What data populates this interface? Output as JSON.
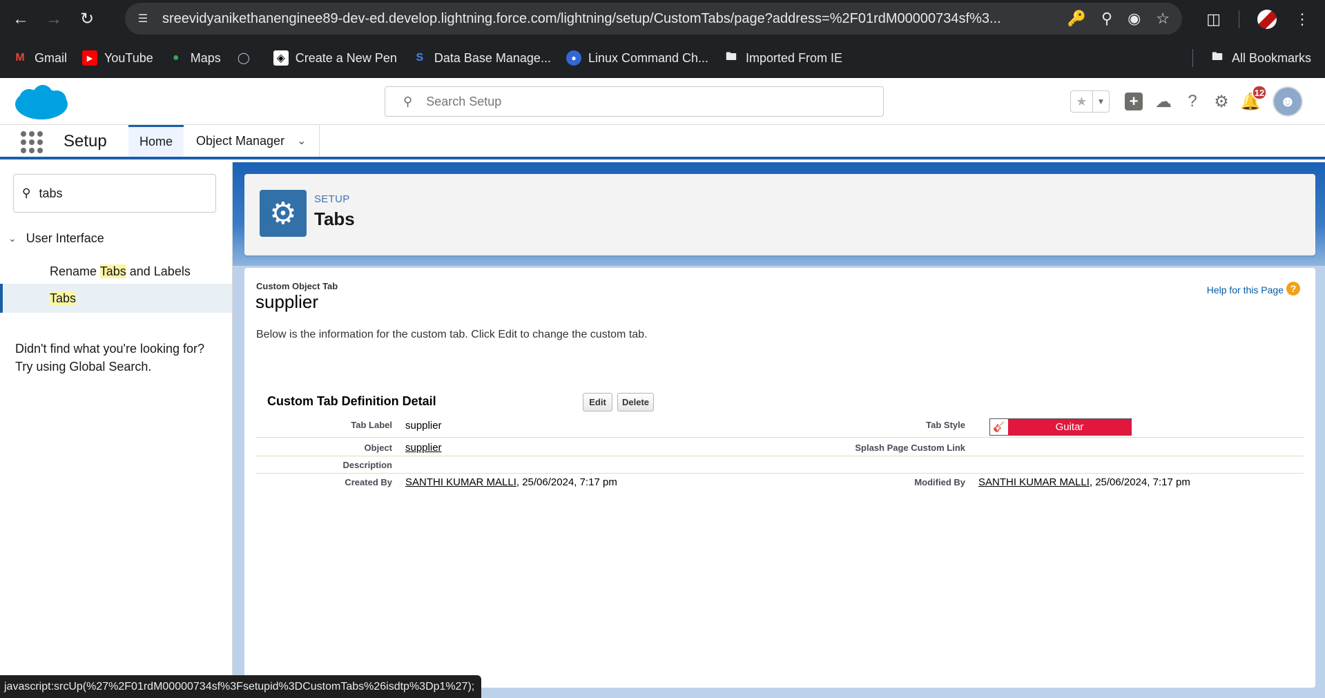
{
  "browser": {
    "url": "sreevidyanikethanenginee89-dev-ed.develop.lightning.force.com/lightning/setup/CustomTabs/page?address=%2F01rdM00000734sf%3...",
    "bookmarks": [
      {
        "label": "Gmail",
        "icon": "gmail-icon"
      },
      {
        "label": "YouTube",
        "icon": "youtube-icon"
      },
      {
        "label": "Maps",
        "icon": "maps-icon"
      },
      {
        "label": "",
        "icon": "globe-icon"
      },
      {
        "label": "Create a New Pen",
        "icon": "codepen-icon"
      },
      {
        "label": "Data Base Manage...",
        "icon": "s-logo-icon"
      },
      {
        "label": "Linux Command Ch...",
        "icon": "blue-circle-icon"
      },
      {
        "label": "Imported From IE",
        "icon": "folder-icon"
      }
    ],
    "all_bookmarks": "All Bookmarks",
    "status_url": "javascript:srcUp(%27%2F01rdM00000734sf%3Fsetupid%3DCustomTabs%26isdtp%3Dp1%27);"
  },
  "header": {
    "search_placeholder": "Search Setup",
    "notification_count": "12"
  },
  "nav": {
    "app_name": "Setup",
    "tabs": [
      {
        "label": "Home"
      },
      {
        "label": "Object Manager"
      }
    ]
  },
  "sidebar": {
    "quickfind_value": "tabs",
    "section": "User Interface",
    "items": [
      {
        "pre": "Rename ",
        "hl": "Tabs",
        "post": " and Labels"
      },
      {
        "pre": "",
        "hl": "Tabs",
        "post": ""
      }
    ],
    "not_found_line1": "Didn't find what you're looking for?",
    "not_found_line2": "Try using Global Search."
  },
  "page_header": {
    "eyebrow": "SETUP",
    "title": "Tabs"
  },
  "content": {
    "type": "Custom Object Tab",
    "name": "supplier",
    "help": "Help for this Page",
    "description": "Below is the information for the custom tab. Click Edit to change the custom tab.",
    "detail_title": "Custom Tab Definition Detail",
    "edit_label": "Edit",
    "delete_label": "Delete",
    "fields": {
      "tab_label": {
        "label": "Tab Label",
        "value": "supplier"
      },
      "tab_style": {
        "label": "Tab Style",
        "value": "Guitar"
      },
      "object": {
        "label": "Object",
        "value": "supplier"
      },
      "splash": {
        "label": "Splash Page Custom Link",
        "value": ""
      },
      "description": {
        "label": "Description",
        "value": ""
      },
      "created_by": {
        "label": "Created By",
        "user": "SANTHI KUMAR MALLI",
        "date": ", 25/06/2024, 7:17 pm"
      },
      "modified_by": {
        "label": "Modified By",
        "user": "SANTHI KUMAR MALLI",
        "date": ", 25/06/2024, 7:17 pm"
      }
    }
  },
  "colors": {
    "accent": "#1b5fa8",
    "tab_style": "#e2173d",
    "highlight": "#fbf5a5"
  }
}
